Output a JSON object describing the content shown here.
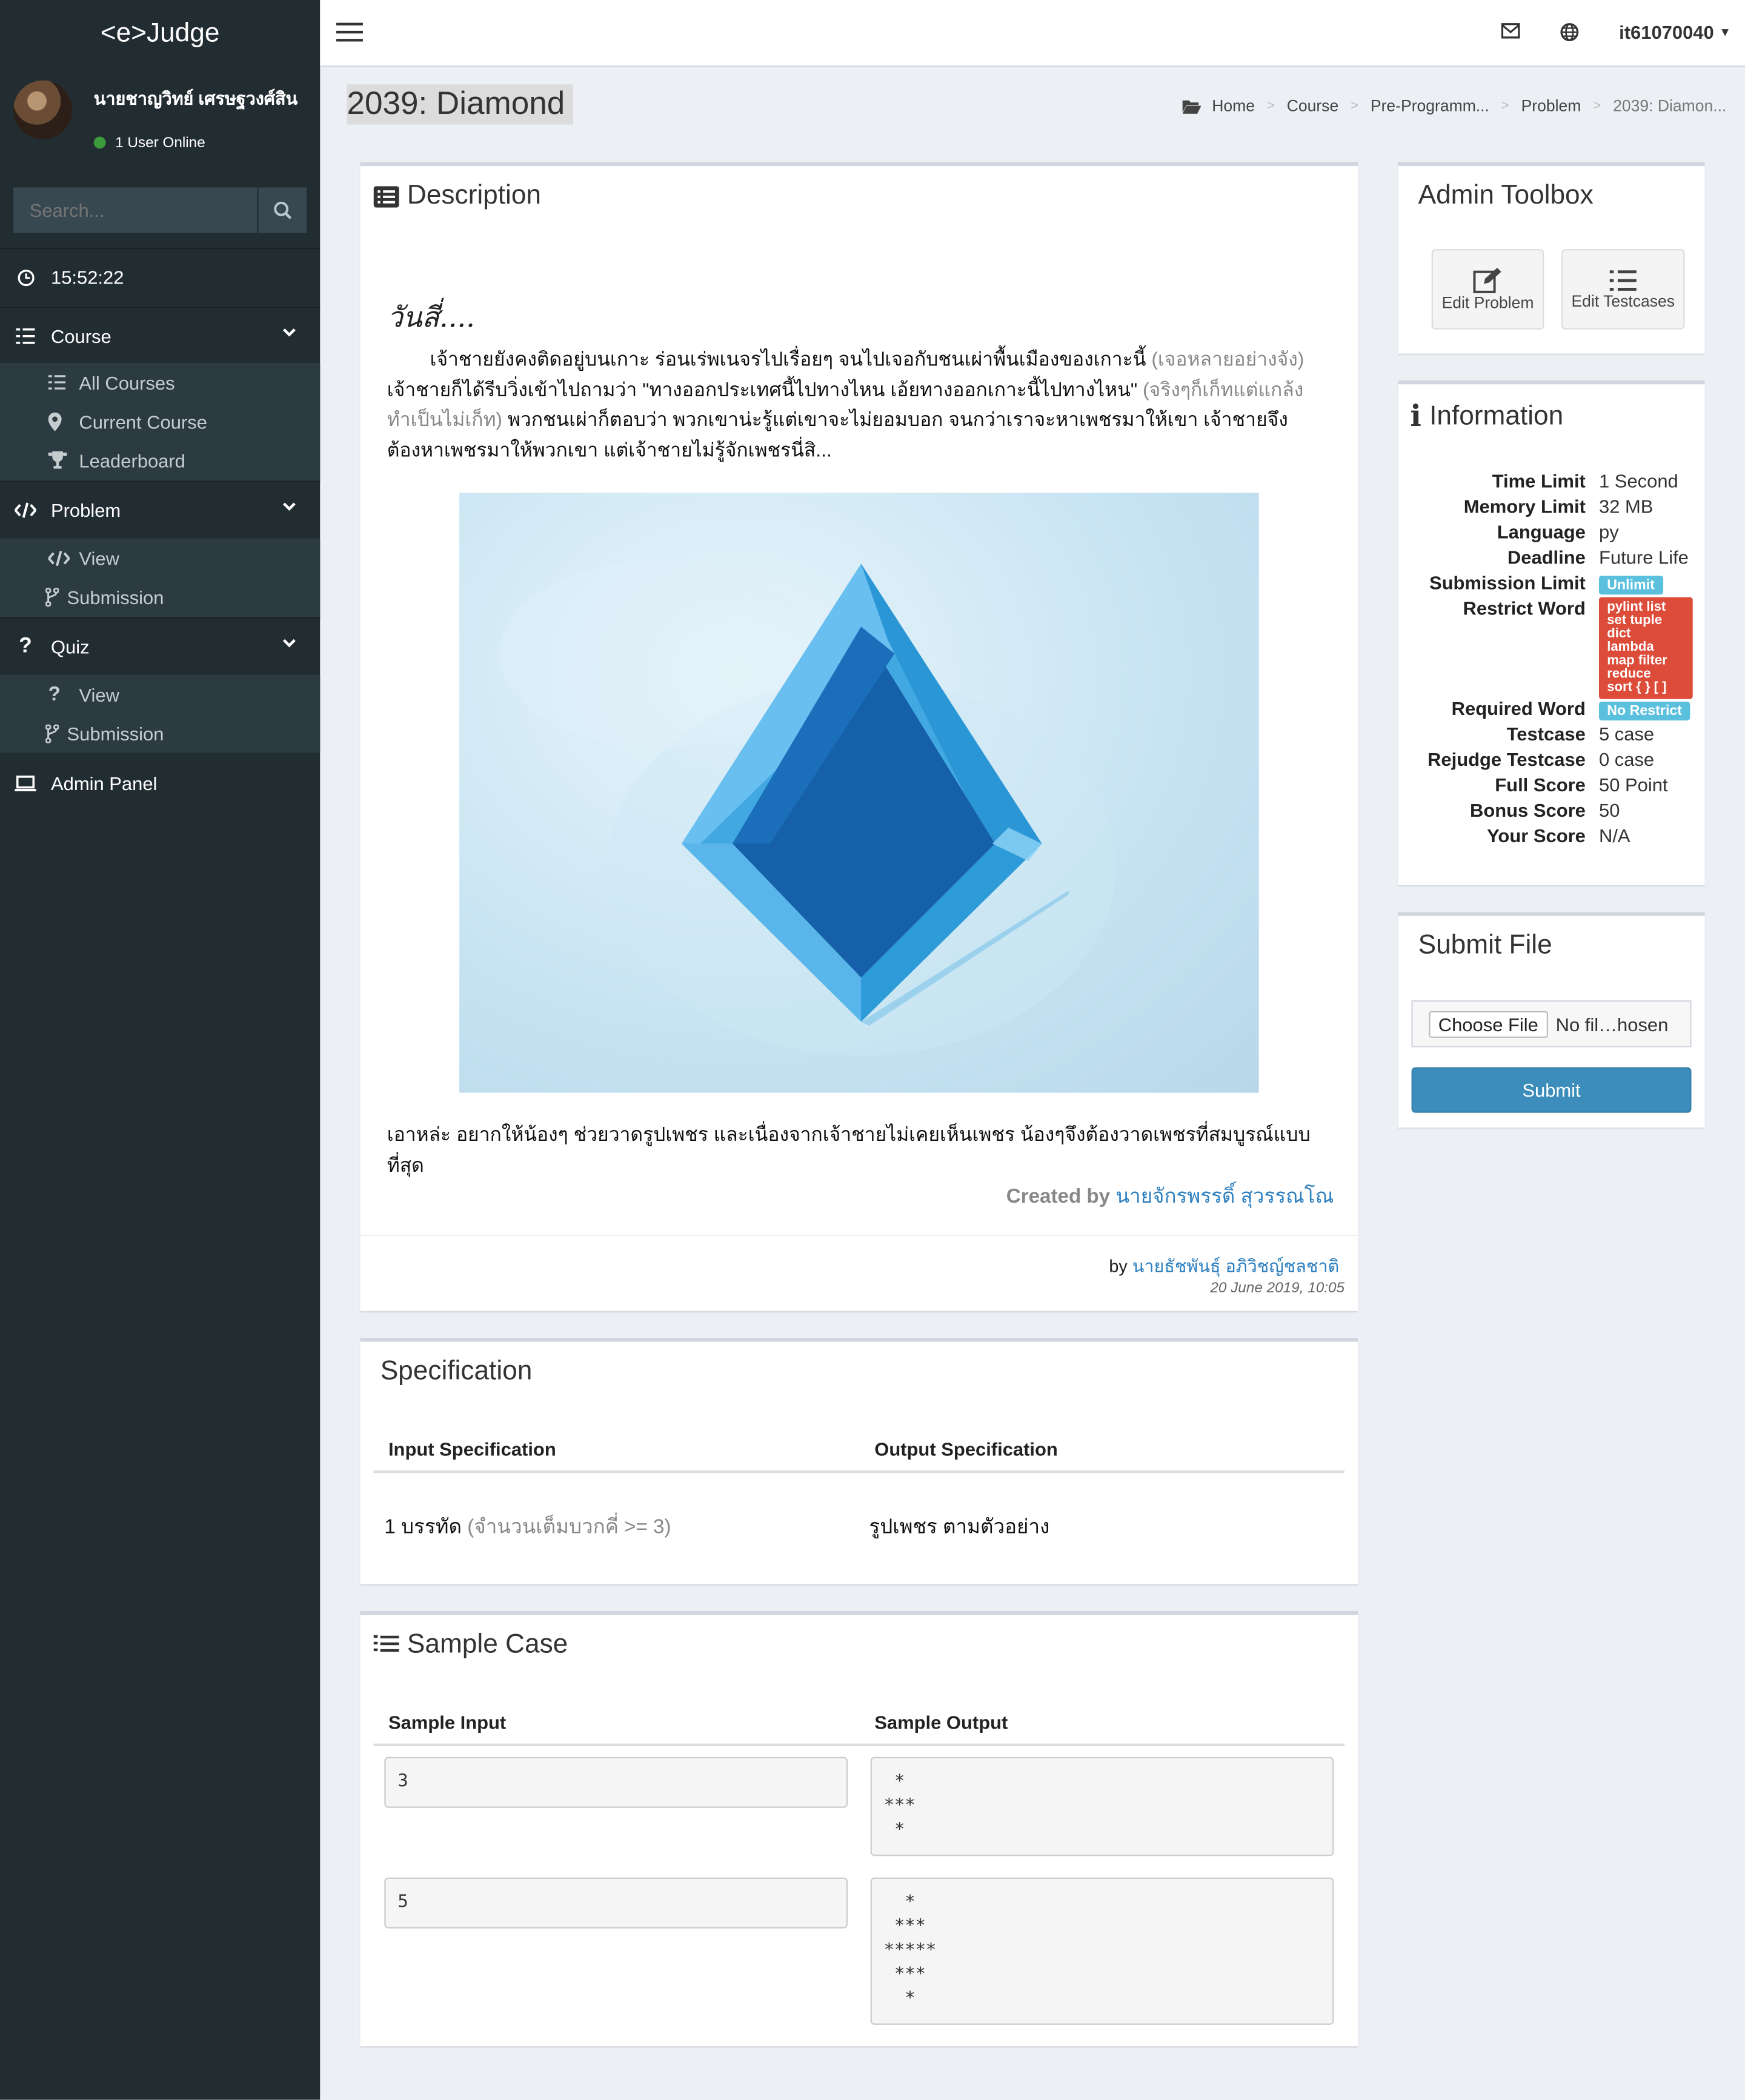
{
  "brand": "<e>Judge",
  "user": {
    "name": "นายชาญวิทย์ เศรษฐวงศ์สิน",
    "online": "1 User Online"
  },
  "search": {
    "placeholder": "Search..."
  },
  "clock": "15:52:22",
  "nav": {
    "course": "Course",
    "all_courses": "All Courses",
    "current_course": "Current Course",
    "leaderboard": "Leaderboard",
    "problem": "Problem",
    "problem_view": "View",
    "problem_submission": "Submission",
    "quiz": "Quiz",
    "quiz_view": "View",
    "quiz_submission": "Submission",
    "admin_panel": "Admin Panel"
  },
  "header": {
    "username": "it61070040"
  },
  "page_title": "2039: Diamond",
  "breadcrumb": [
    "Home",
    "Course",
    "Pre-Programm...",
    "Problem",
    "2039: Diamon..."
  ],
  "description": {
    "title": "Description",
    "heading": "วันสี่....",
    "para1_a": "        เจ้าชายยังคงติดอยู่บนเกาะ ร่อนเร่พเนจรไปเรื่อยๆ จนไปเจอกับชนเผ่าพื้นเมืองของเกาะนี้ ",
    "para1_b": "(เจอหลายอย่างจัง)",
    "para1_c": " เจ้าชายก็ได้รีบวิ่งเข้าไปถามว่า \"ทางออกประเทศนี้ไปทางไหน เอ้ยทางออกเกาะนี้ไปทางไหน\" ",
    "para1_d": "(จริงๆก็เก็ทแต่แกล้งทำเป็นไม่เก็ท)",
    "para1_e": " พวกชนเผ่าก็ตอบว่า พวกเขาน่ะรู้แต่เขาจะไม่ยอมบอก จนกว่าเราจะหาเพชรมาให้เขา เจ้าชายจึงต้องหาเพชรมาให้พวกเขา แต่เจ้าชายไม่รู้จักเพชรนี่สิ...",
    "para2": "เอาหล่ะ อยากให้น้องๆ ช่วยวาดรูปเพชร และเนื่องจากเจ้าชายไม่เคยเห็นเพชร น้องๆจึงต้องวาดเพชรที่สมบูรณ์แบบที่สุด",
    "created_label": "Created by",
    "created_name": "นายจักรพรรดิ์ สุวรรณโณ",
    "by_label": "by",
    "by_name": "นายธัชพันธุ์ อภิวิชญ์ชลชาติ",
    "date": "20 June 2019, 10:05"
  },
  "specification": {
    "title": "Specification",
    "input_header": "Input Specification",
    "output_header": "Output Specification",
    "input_a": "1 บรรทัด ",
    "input_b": "(จำนวนเต็มบวกคี่ >= 3)",
    "output": "รูปเพชร ตามตัวอย่าง"
  },
  "sample": {
    "title": "Sample Case",
    "input_header": "Sample Input",
    "output_header": "Sample Output",
    "cases": [
      {
        "input": "3",
        "output": " *\n***\n *"
      },
      {
        "input": "5",
        "output": "  *\n ***\n*****\n ***\n  *"
      }
    ]
  },
  "toolbox": {
    "title": "Admin Toolbox",
    "edit_problem": "Edit Problem",
    "edit_testcases": "Edit Testcases"
  },
  "information": {
    "title": "Information",
    "time_limit_k": "Time Limit",
    "time_limit_v": "1 Second",
    "memory_limit_k": "Memory Limit",
    "memory_limit_v": "32 MB",
    "language_k": "Language",
    "language_v": "py",
    "deadline_k": "Deadline",
    "deadline_v": "Future Life",
    "submission_limit_k": "Submission Limit",
    "submission_limit_v": "Unlimit",
    "restrict_word_k": "Restrict Word",
    "restrict_words": [
      "pylint list",
      "set tuple",
      "dict",
      "lambda",
      "map filter",
      "reduce",
      "sort { } [ ]"
    ],
    "required_word_k": "Required Word",
    "required_word_v": "No Restrict",
    "testcase_k": "Testcase",
    "testcase_v": "5 case",
    "rejudge_k": "Rejudge Testcase",
    "rejudge_v": "0 case",
    "full_score_k": "Full Score",
    "full_score_v": "50 Point",
    "bonus_score_k": "Bonus Score",
    "bonus_score_v": "50",
    "your_score_k": "Your Score",
    "your_score_v": "N/A"
  },
  "submit": {
    "title": "Submit File",
    "choose": "Choose File",
    "no_file": "No fil…hosen",
    "button": "Submit"
  },
  "colors": {
    "sidebar": "#222d32",
    "submenu": "#2c3b41",
    "primary": "#3c8dbc",
    "danger": "#dd4b39",
    "info": "#5bc0de"
  }
}
